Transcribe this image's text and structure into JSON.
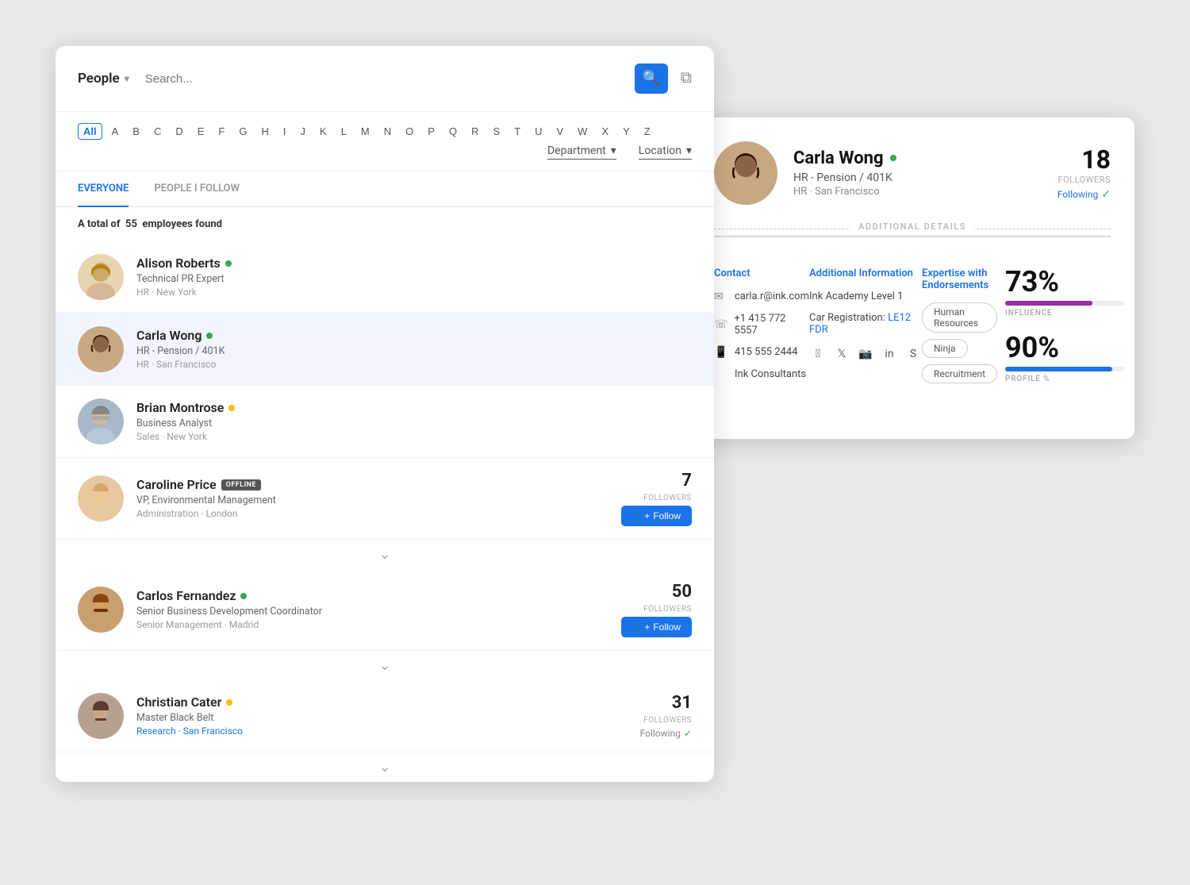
{
  "app": {
    "title": "People",
    "search_placeholder": "Search...",
    "search_btn_icon": "🔍",
    "filter_icon": "⧉"
  },
  "alphabet": {
    "active": "All",
    "letters": [
      "All",
      "A",
      "B",
      "C",
      "D",
      "E",
      "F",
      "G",
      "H",
      "I",
      "J",
      "K",
      "L",
      "M",
      "N",
      "O",
      "P",
      "Q",
      "R",
      "S",
      "T",
      "U",
      "V",
      "W",
      "X",
      "Y",
      "Z"
    ]
  },
  "filters": {
    "department": "Department",
    "location": "Location"
  },
  "tabs": [
    {
      "label": "EVERYONE",
      "active": true
    },
    {
      "label": "PEOPLE I FOLLOW",
      "active": false
    }
  ],
  "employees_count": "55",
  "employees_label": "A total of",
  "employees_suffix": "employees found",
  "people": [
    {
      "name": "Alison Roberts",
      "title": "Technical PR Expert",
      "dept": "HR",
      "loc": "New York",
      "status": "green",
      "offline": false,
      "followers": null,
      "following": false
    },
    {
      "name": "Carla Wong",
      "title": "HR - Pension / 401K",
      "dept": "HR",
      "loc": "San Francisco",
      "status": "green",
      "offline": false,
      "followers": null,
      "following": false,
      "selected": true
    },
    {
      "name": "Brian Montrose",
      "title": "Business Analyst",
      "dept": "Sales",
      "loc": "New York",
      "status": "orange",
      "offline": false,
      "followers": null,
      "following": false
    },
    {
      "name": "Caroline Price",
      "title": "VP, Environmental Management",
      "dept": "Administration",
      "loc": "London",
      "status": null,
      "offline": true,
      "followers": "7",
      "followers_label": "FOLLOWERS",
      "following": false
    },
    {
      "name": "Carlos Fernandez",
      "title": "Senior Business Development Coordinator",
      "dept": "Senior Management",
      "loc": "Madrid",
      "status": "green",
      "offline": false,
      "followers": "50",
      "followers_label": "FOLLOWERS",
      "following": false
    },
    {
      "name": "Christian Cater",
      "title": "Master Black Belt",
      "dept": "Research",
      "loc": "San Francisco",
      "status": "orange",
      "offline": false,
      "followers": "31",
      "followers_label": "FOLLOWERS",
      "following": true
    }
  ],
  "detail": {
    "name": "Carla Wong",
    "role": "HR - Pension / 401K",
    "location": "HR · San Francisco",
    "followers_num": "18",
    "followers_label": "FOLLOWERS",
    "following_label": "Following",
    "sections": {
      "additional_details": "ADDITIONAL DETAILS"
    },
    "contact": {
      "header": "Contact",
      "email": "carla.r@ink.com",
      "phone": "+1 415 772 5557",
      "mobile": "415 555 2444",
      "company": "Ink Consultants"
    },
    "additional_info": {
      "header": "Additional Information",
      "ink_academy": "Ink Academy Level 1",
      "car_reg_label": "Car Registration:",
      "car_reg_value": "LE12 FDR",
      "socials": [
        "fb",
        "tw",
        "ig",
        "li",
        "sk"
      ]
    },
    "expertise": {
      "header": "Expertise with Endorsements",
      "tags": [
        "Human Resources",
        "Ninja",
        "Recruitment"
      ]
    },
    "metrics": {
      "influence_value": "73%",
      "influence_label": "INFLUENCE",
      "influence_pct": 73,
      "profile_value": "90%",
      "profile_label": "PROFILE %",
      "profile_pct": 90
    }
  },
  "buttons": {
    "follow": "Follow",
    "following": "Following",
    "offline": "OFFLINE"
  }
}
